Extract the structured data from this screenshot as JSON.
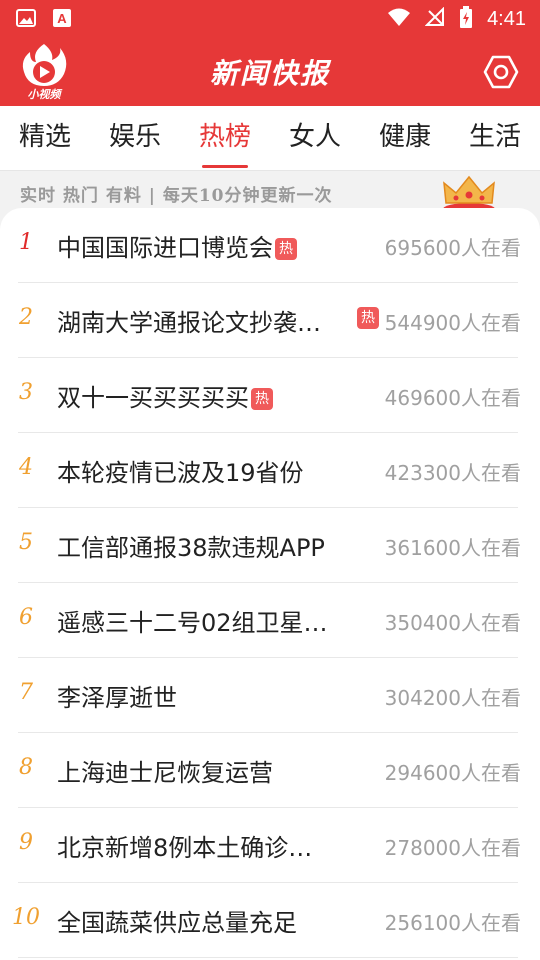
{
  "status_bar": {
    "time": "4:41"
  },
  "header": {
    "title": "新闻快报",
    "logo_text": "小视频"
  },
  "tabs": [
    {
      "label": "精选"
    },
    {
      "label": "娱乐"
    },
    {
      "label": "热榜",
      "active": true
    },
    {
      "label": "女人"
    },
    {
      "label": "健康"
    },
    {
      "label": "生活"
    }
  ],
  "banner": {
    "slogan": "实时 热门 有料 | 每天10分钟更新一次"
  },
  "hot_badge": "热",
  "items": [
    {
      "rank": "1",
      "title": "中国国际进口博览会",
      "views": "695600人在看",
      "hot": true
    },
    {
      "rank": "2",
      "title": "湖南大学通报论文抄袭…",
      "views": "544900人在看",
      "hot": true
    },
    {
      "rank": "3",
      "title": "双十一买买买买买",
      "views": "469600人在看",
      "hot": true
    },
    {
      "rank": "4",
      "title": "本轮疫情已波及19省份",
      "views": "423300人在看",
      "hot": false
    },
    {
      "rank": "5",
      "title": "工信部通报38款违规APP",
      "views": "361600人在看",
      "hot": false
    },
    {
      "rank": "6",
      "title": "遥感三十二号02组卫星…",
      "views": "350400人在看",
      "hot": false
    },
    {
      "rank": "7",
      "title": "李泽厚逝世",
      "views": "304200人在看",
      "hot": false
    },
    {
      "rank": "8",
      "title": "上海迪士尼恢复运营",
      "views": "294600人在看",
      "hot": false
    },
    {
      "rank": "9",
      "title": "北京新增8例本土确诊…",
      "views": "278000人在看",
      "hot": false
    },
    {
      "rank": "10",
      "title": "全国蔬菜供应总量充足",
      "views": "256100人在看",
      "hot": false
    }
  ],
  "colors": {
    "brand": "#e63838",
    "rank_top": "#e02b2b",
    "rank_other": "#f0a030"
  }
}
